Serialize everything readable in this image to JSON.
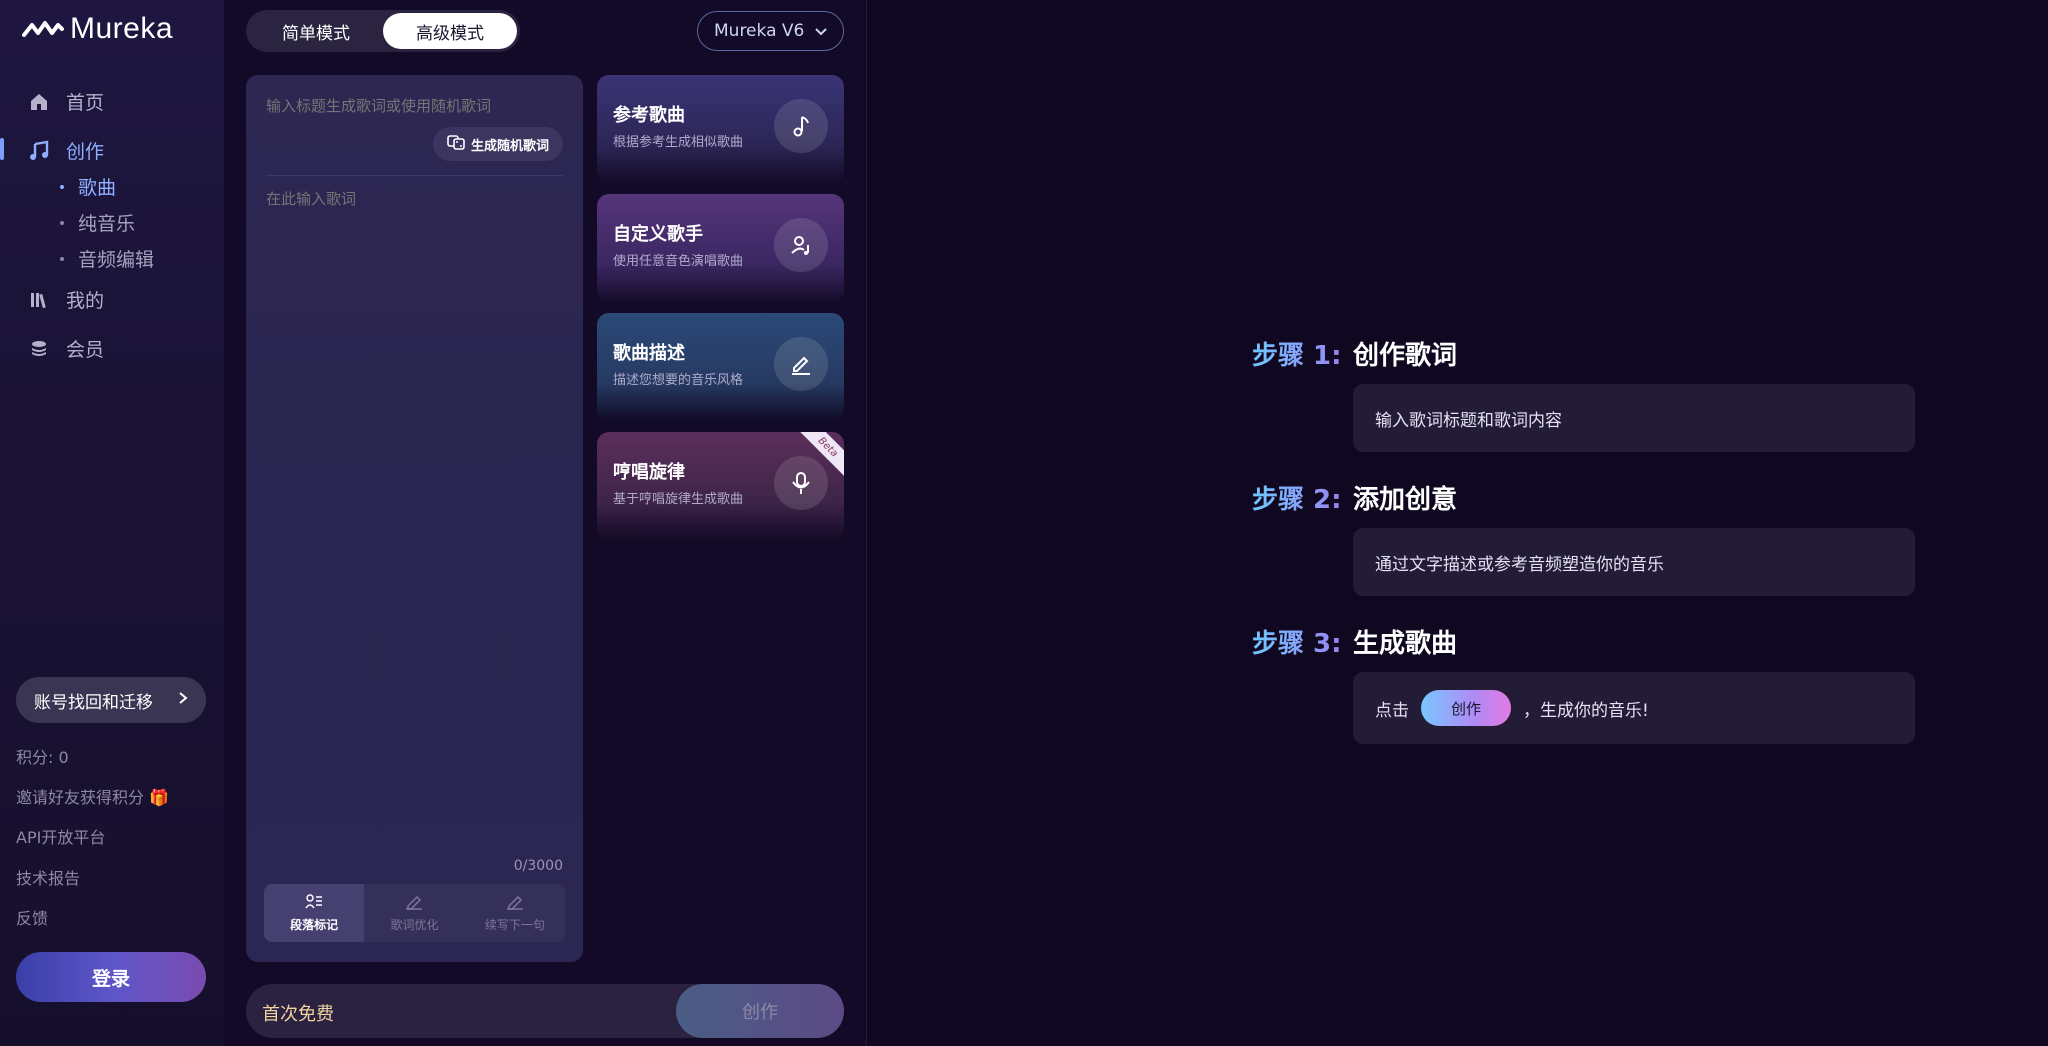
{
  "app": {
    "name": "Mureka"
  },
  "sidebar": {
    "nav": [
      {
        "label": "首页",
        "icon": "home-icon"
      },
      {
        "label": "创作",
        "icon": "music-note-icon"
      },
      {
        "label": "我的",
        "icon": "library-icon"
      },
      {
        "label": "会员",
        "icon": "coins-icon"
      }
    ],
    "create_sub": [
      {
        "label": "歌曲"
      },
      {
        "label": "纯音乐"
      },
      {
        "label": "音频编辑"
      }
    ],
    "migrate_label": "账号找回和迁移",
    "points": "积分: 0",
    "invite": "邀请好友获得积分 🎁",
    "api": "API开放平台",
    "report": "技术报告",
    "feedback": "反馈",
    "login": "登录"
  },
  "header": {
    "modes": [
      "简单模式",
      "高级模式"
    ],
    "active_mode": "高级模式",
    "model": "Mureka V6"
  },
  "editor": {
    "title_placeholder": "输入标题生成歌词或使用随机歌词",
    "random_btn": "生成随机歌词",
    "lyrics_placeholder": "在此输入歌词",
    "counter": "0/3000",
    "tools": [
      "段落标记",
      "歌词优化",
      "续写下一句"
    ]
  },
  "cards": [
    {
      "title": "参考歌曲",
      "sub": "根据参考生成相似歌曲",
      "icon": "music-note-icon"
    },
    {
      "title": "自定义歌手",
      "sub": "使用任意音色演唱歌曲",
      "icon": "singer-icon"
    },
    {
      "title": "歌曲描述",
      "sub": "描述您想要的音乐风格",
      "icon": "pencil-icon"
    },
    {
      "title": "哼唱旋律",
      "sub": "基于哼唱旋律生成歌曲",
      "icon": "microphone-icon",
      "badge": "Beta"
    }
  ],
  "bottom": {
    "free": "首次免费",
    "create": "创作"
  },
  "steps": [
    {
      "label": "步骤 1:",
      "title": "创作歌词",
      "desc": "输入歌词标题和歌词内容"
    },
    {
      "label": "步骤 2:",
      "title": "添加创意",
      "desc": "通过文字描述或参考音频塑造你的音乐"
    },
    {
      "label": "步骤 3:",
      "title": "生成歌曲",
      "desc_before": "点击",
      "desc_button": "创作",
      "desc_after": "，生成你的音乐!"
    }
  ],
  "colors": {
    "background": "#0f0820",
    "accent": "#8fb0ff",
    "free_text": "#f0d3a0"
  }
}
